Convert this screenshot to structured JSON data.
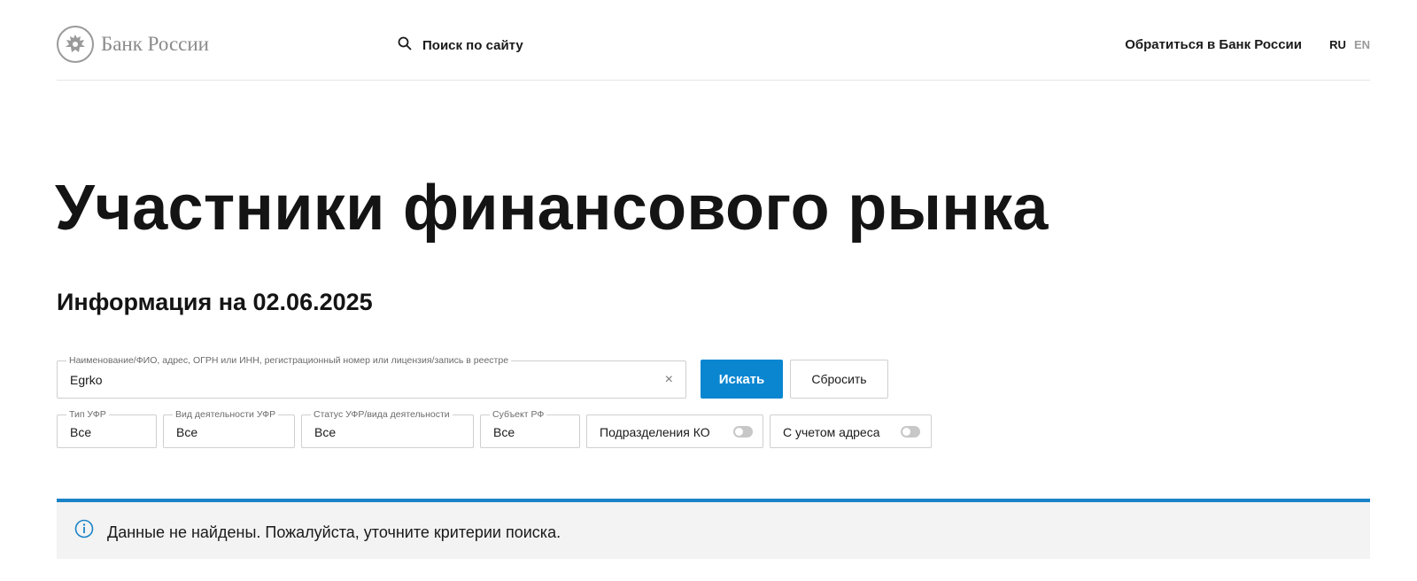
{
  "header": {
    "logo_text": "Банк России",
    "search_label": "Поиск по сайту",
    "contact_label": "Обратиться в Банк России",
    "lang_ru": "RU",
    "lang_en": "EN"
  },
  "page": {
    "title": "Участники финансового рынка",
    "info_date": "Информация на 02.06.2025"
  },
  "search_form": {
    "main_field": {
      "label": "Наименование/ФИО, адрес, ОГРН или ИНН, регистрационный номер или лицензия/запись в реестре",
      "value": "Egrko",
      "clear_symbol": "×"
    },
    "search_button": "Искать",
    "reset_button": "Сбросить",
    "filters": [
      {
        "label": "Тип УФР",
        "value": "Все"
      },
      {
        "label": "Вид деятельности УФР",
        "value": "Все"
      },
      {
        "label": "Статус УФР/вида деятельности",
        "value": "Все"
      },
      {
        "label": "Субъект РФ",
        "value": "Все"
      }
    ],
    "toggles": [
      {
        "label": "Подразделения КО",
        "state": "off"
      },
      {
        "label": "С учетом адреса",
        "state": "off"
      }
    ]
  },
  "notice": {
    "text": "Данные не найдены. Пожалуйста, уточните критерии поиска.",
    "icon": "info-icon"
  },
  "colors": {
    "accent": "#0a86d1",
    "notice_border": "#1a84c7",
    "notice_bg": "#f3f3f3"
  }
}
